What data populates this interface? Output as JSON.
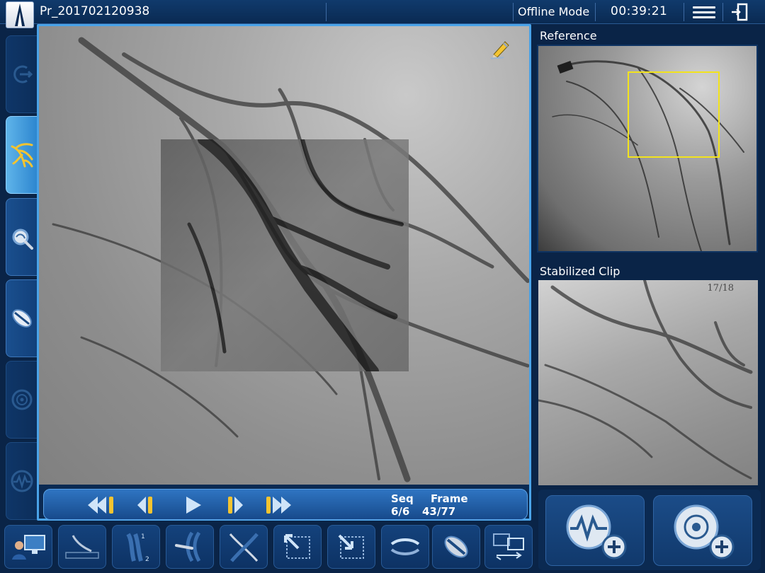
{
  "topbar": {
    "title": "Pr_201702120938",
    "mode": "Offline Mode",
    "time": "00:39:21",
    "menu_icon": "hamburger-menu-icon",
    "exit_icon": "exit-icon"
  },
  "left_toolbar": {
    "items": [
      {
        "name": "undo-icon",
        "state": "disabled"
      },
      {
        "name": "vessel-tree-icon",
        "state": "active"
      },
      {
        "name": "magnifier-icon",
        "state": "enabled"
      },
      {
        "name": "stent-icon",
        "state": "enabled"
      },
      {
        "name": "target-icon",
        "state": "disabled"
      },
      {
        "name": "waveform-icon",
        "state": "disabled"
      }
    ]
  },
  "player": {
    "seq_label": "Seq",
    "frame_label": "Frame",
    "seq_value": "6/6",
    "frame_value": "43/77",
    "progress_fraction": 0.56
  },
  "reference": {
    "label": "Reference"
  },
  "stabilized": {
    "label": "Stabilized Clip",
    "counter": "17/18"
  },
  "bottom_toolbar": {
    "items": [
      "workstation-icon",
      "ruler-icon",
      "vessel-1-2-icon",
      "vessel-probe-icon",
      "crossing-lines-icon",
      "roi-expand-icon",
      "roi-shrink-icon",
      "sync-arrows-icon",
      "stent-icon",
      "compare-screens-icon"
    ]
  },
  "colors": {
    "accent": "#4aa3e8",
    "roi": "#f2e31d",
    "background": "#0a2447"
  }
}
